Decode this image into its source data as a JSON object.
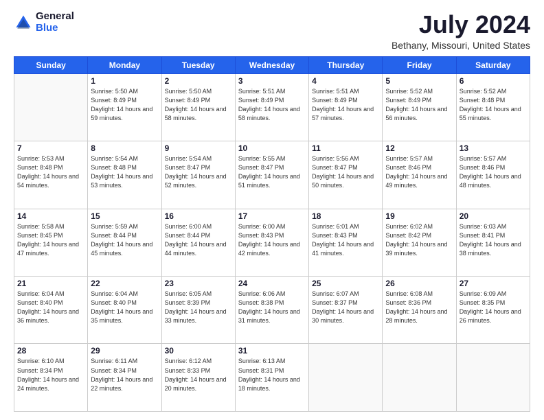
{
  "header": {
    "logo": {
      "general": "General",
      "blue": "Blue"
    },
    "title": "July 2024",
    "location": "Bethany, Missouri, United States"
  },
  "calendar": {
    "days_of_week": [
      "Sunday",
      "Monday",
      "Tuesday",
      "Wednesday",
      "Thursday",
      "Friday",
      "Saturday"
    ],
    "weeks": [
      [
        {
          "day": "",
          "sunrise": "",
          "sunset": "",
          "daylight": ""
        },
        {
          "day": "1",
          "sunrise": "Sunrise: 5:50 AM",
          "sunset": "Sunset: 8:49 PM",
          "daylight": "Daylight: 14 hours and 59 minutes."
        },
        {
          "day": "2",
          "sunrise": "Sunrise: 5:50 AM",
          "sunset": "Sunset: 8:49 PM",
          "daylight": "Daylight: 14 hours and 58 minutes."
        },
        {
          "day": "3",
          "sunrise": "Sunrise: 5:51 AM",
          "sunset": "Sunset: 8:49 PM",
          "daylight": "Daylight: 14 hours and 58 minutes."
        },
        {
          "day": "4",
          "sunrise": "Sunrise: 5:51 AM",
          "sunset": "Sunset: 8:49 PM",
          "daylight": "Daylight: 14 hours and 57 minutes."
        },
        {
          "day": "5",
          "sunrise": "Sunrise: 5:52 AM",
          "sunset": "Sunset: 8:49 PM",
          "daylight": "Daylight: 14 hours and 56 minutes."
        },
        {
          "day": "6",
          "sunrise": "Sunrise: 5:52 AM",
          "sunset": "Sunset: 8:48 PM",
          "daylight": "Daylight: 14 hours and 55 minutes."
        }
      ],
      [
        {
          "day": "7",
          "sunrise": "Sunrise: 5:53 AM",
          "sunset": "Sunset: 8:48 PM",
          "daylight": "Daylight: 14 hours and 54 minutes."
        },
        {
          "day": "8",
          "sunrise": "Sunrise: 5:54 AM",
          "sunset": "Sunset: 8:48 PM",
          "daylight": "Daylight: 14 hours and 53 minutes."
        },
        {
          "day": "9",
          "sunrise": "Sunrise: 5:54 AM",
          "sunset": "Sunset: 8:47 PM",
          "daylight": "Daylight: 14 hours and 52 minutes."
        },
        {
          "day": "10",
          "sunrise": "Sunrise: 5:55 AM",
          "sunset": "Sunset: 8:47 PM",
          "daylight": "Daylight: 14 hours and 51 minutes."
        },
        {
          "day": "11",
          "sunrise": "Sunrise: 5:56 AM",
          "sunset": "Sunset: 8:47 PM",
          "daylight": "Daylight: 14 hours and 50 minutes."
        },
        {
          "day": "12",
          "sunrise": "Sunrise: 5:57 AM",
          "sunset": "Sunset: 8:46 PM",
          "daylight": "Daylight: 14 hours and 49 minutes."
        },
        {
          "day": "13",
          "sunrise": "Sunrise: 5:57 AM",
          "sunset": "Sunset: 8:46 PM",
          "daylight": "Daylight: 14 hours and 48 minutes."
        }
      ],
      [
        {
          "day": "14",
          "sunrise": "Sunrise: 5:58 AM",
          "sunset": "Sunset: 8:45 PM",
          "daylight": "Daylight: 14 hours and 47 minutes."
        },
        {
          "day": "15",
          "sunrise": "Sunrise: 5:59 AM",
          "sunset": "Sunset: 8:44 PM",
          "daylight": "Daylight: 14 hours and 45 minutes."
        },
        {
          "day": "16",
          "sunrise": "Sunrise: 6:00 AM",
          "sunset": "Sunset: 8:44 PM",
          "daylight": "Daylight: 14 hours and 44 minutes."
        },
        {
          "day": "17",
          "sunrise": "Sunrise: 6:00 AM",
          "sunset": "Sunset: 8:43 PM",
          "daylight": "Daylight: 14 hours and 42 minutes."
        },
        {
          "day": "18",
          "sunrise": "Sunrise: 6:01 AM",
          "sunset": "Sunset: 8:43 PM",
          "daylight": "Daylight: 14 hours and 41 minutes."
        },
        {
          "day": "19",
          "sunrise": "Sunrise: 6:02 AM",
          "sunset": "Sunset: 8:42 PM",
          "daylight": "Daylight: 14 hours and 39 minutes."
        },
        {
          "day": "20",
          "sunrise": "Sunrise: 6:03 AM",
          "sunset": "Sunset: 8:41 PM",
          "daylight": "Daylight: 14 hours and 38 minutes."
        }
      ],
      [
        {
          "day": "21",
          "sunrise": "Sunrise: 6:04 AM",
          "sunset": "Sunset: 8:40 PM",
          "daylight": "Daylight: 14 hours and 36 minutes."
        },
        {
          "day": "22",
          "sunrise": "Sunrise: 6:04 AM",
          "sunset": "Sunset: 8:40 PM",
          "daylight": "Daylight: 14 hours and 35 minutes."
        },
        {
          "day": "23",
          "sunrise": "Sunrise: 6:05 AM",
          "sunset": "Sunset: 8:39 PM",
          "daylight": "Daylight: 14 hours and 33 minutes."
        },
        {
          "day": "24",
          "sunrise": "Sunrise: 6:06 AM",
          "sunset": "Sunset: 8:38 PM",
          "daylight": "Daylight: 14 hours and 31 minutes."
        },
        {
          "day": "25",
          "sunrise": "Sunrise: 6:07 AM",
          "sunset": "Sunset: 8:37 PM",
          "daylight": "Daylight: 14 hours and 30 minutes."
        },
        {
          "day": "26",
          "sunrise": "Sunrise: 6:08 AM",
          "sunset": "Sunset: 8:36 PM",
          "daylight": "Daylight: 14 hours and 28 minutes."
        },
        {
          "day": "27",
          "sunrise": "Sunrise: 6:09 AM",
          "sunset": "Sunset: 8:35 PM",
          "daylight": "Daylight: 14 hours and 26 minutes."
        }
      ],
      [
        {
          "day": "28",
          "sunrise": "Sunrise: 6:10 AM",
          "sunset": "Sunset: 8:34 PM",
          "daylight": "Daylight: 14 hours and 24 minutes."
        },
        {
          "day": "29",
          "sunrise": "Sunrise: 6:11 AM",
          "sunset": "Sunset: 8:34 PM",
          "daylight": "Daylight: 14 hours and 22 minutes."
        },
        {
          "day": "30",
          "sunrise": "Sunrise: 6:12 AM",
          "sunset": "Sunset: 8:33 PM",
          "daylight": "Daylight: 14 hours and 20 minutes."
        },
        {
          "day": "31",
          "sunrise": "Sunrise: 6:13 AM",
          "sunset": "Sunset: 8:31 PM",
          "daylight": "Daylight: 14 hours and 18 minutes."
        },
        {
          "day": "",
          "sunrise": "",
          "sunset": "",
          "daylight": ""
        },
        {
          "day": "",
          "sunrise": "",
          "sunset": "",
          "daylight": ""
        },
        {
          "day": "",
          "sunrise": "",
          "sunset": "",
          "daylight": ""
        }
      ]
    ]
  }
}
